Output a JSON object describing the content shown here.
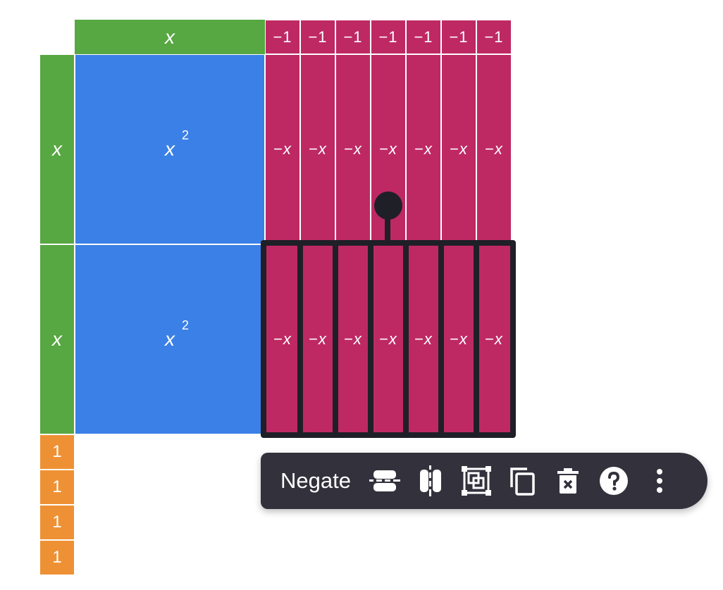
{
  "top_factor": {
    "x_label": "x",
    "neg_ones": [
      "−1",
      "−1",
      "−1",
      "−1",
      "−1",
      "−1",
      "−1"
    ]
  },
  "left_factor": {
    "x_labels": [
      "x",
      "x"
    ],
    "ones": [
      "1",
      "1",
      "1",
      "1"
    ]
  },
  "product": {
    "x_squared_base": "x",
    "x_squared_exp": "2",
    "neg_x_sign": "−",
    "neg_x_var": "x"
  },
  "toolbar": {
    "negate_label": "Negate",
    "icons": [
      "flip-horizontal-icon",
      "flip-vertical-icon",
      "group-icon",
      "duplicate-icon",
      "delete-icon",
      "help-icon",
      "more-icon"
    ]
  },
  "colors": {
    "x_tile": "#57a742",
    "x_squared_tile": "#3a80e6",
    "negative_tile": "#be2964",
    "one_tile": "#ee9134",
    "selection": "#1f1f27",
    "toolbar_bg": "#32313c"
  }
}
